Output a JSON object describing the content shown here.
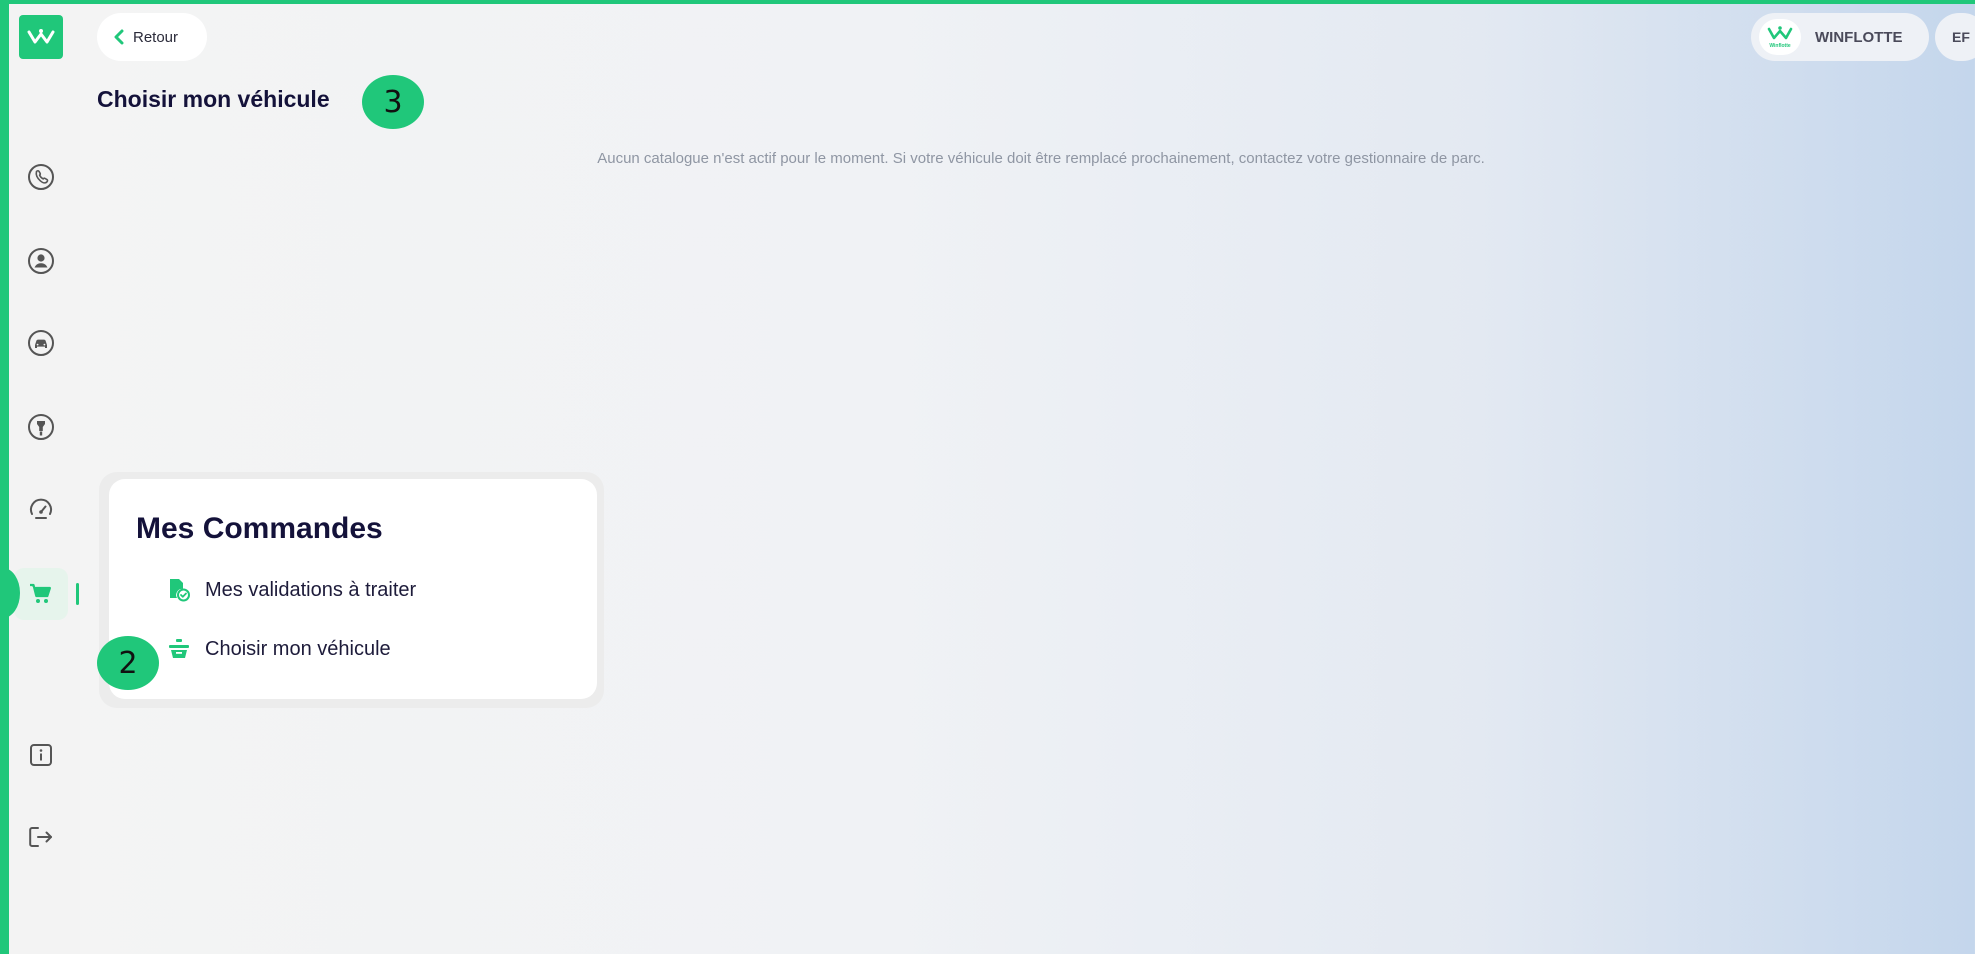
{
  "header": {
    "back_label": "Retour",
    "page_title": "Choisir mon véhicule",
    "org_name": "WINFLOTTE",
    "user_initials": "EF"
  },
  "main": {
    "empty_message": "Aucun catalogue n'est actif pour le moment. Si votre véhicule doit être remplacé prochainement, contactez votre gestionnaire de parc."
  },
  "card": {
    "title": "Mes Commandes",
    "links": [
      {
        "label": "Mes validations à traiter",
        "icon": "document-check-icon"
      },
      {
        "label": "Choisir mon véhicule",
        "icon": "vehicle-basket-icon"
      }
    ]
  },
  "sidebar": {
    "items": [
      {
        "icon": "phone-icon"
      },
      {
        "icon": "user-icon"
      },
      {
        "icon": "car-icon"
      },
      {
        "icon": "fuel-pump-icon"
      },
      {
        "icon": "gauge-icon"
      },
      {
        "icon": "cart-icon",
        "active": true
      },
      {
        "icon": "info-icon"
      },
      {
        "icon": "logout-icon"
      }
    ]
  },
  "markers": {
    "step_2": "2",
    "step_3": "3"
  },
  "colors": {
    "accent": "#20c77a",
    "title": "#14123a",
    "muted": "#8f96a3"
  },
  "org_logo_caption": "Winflotte"
}
